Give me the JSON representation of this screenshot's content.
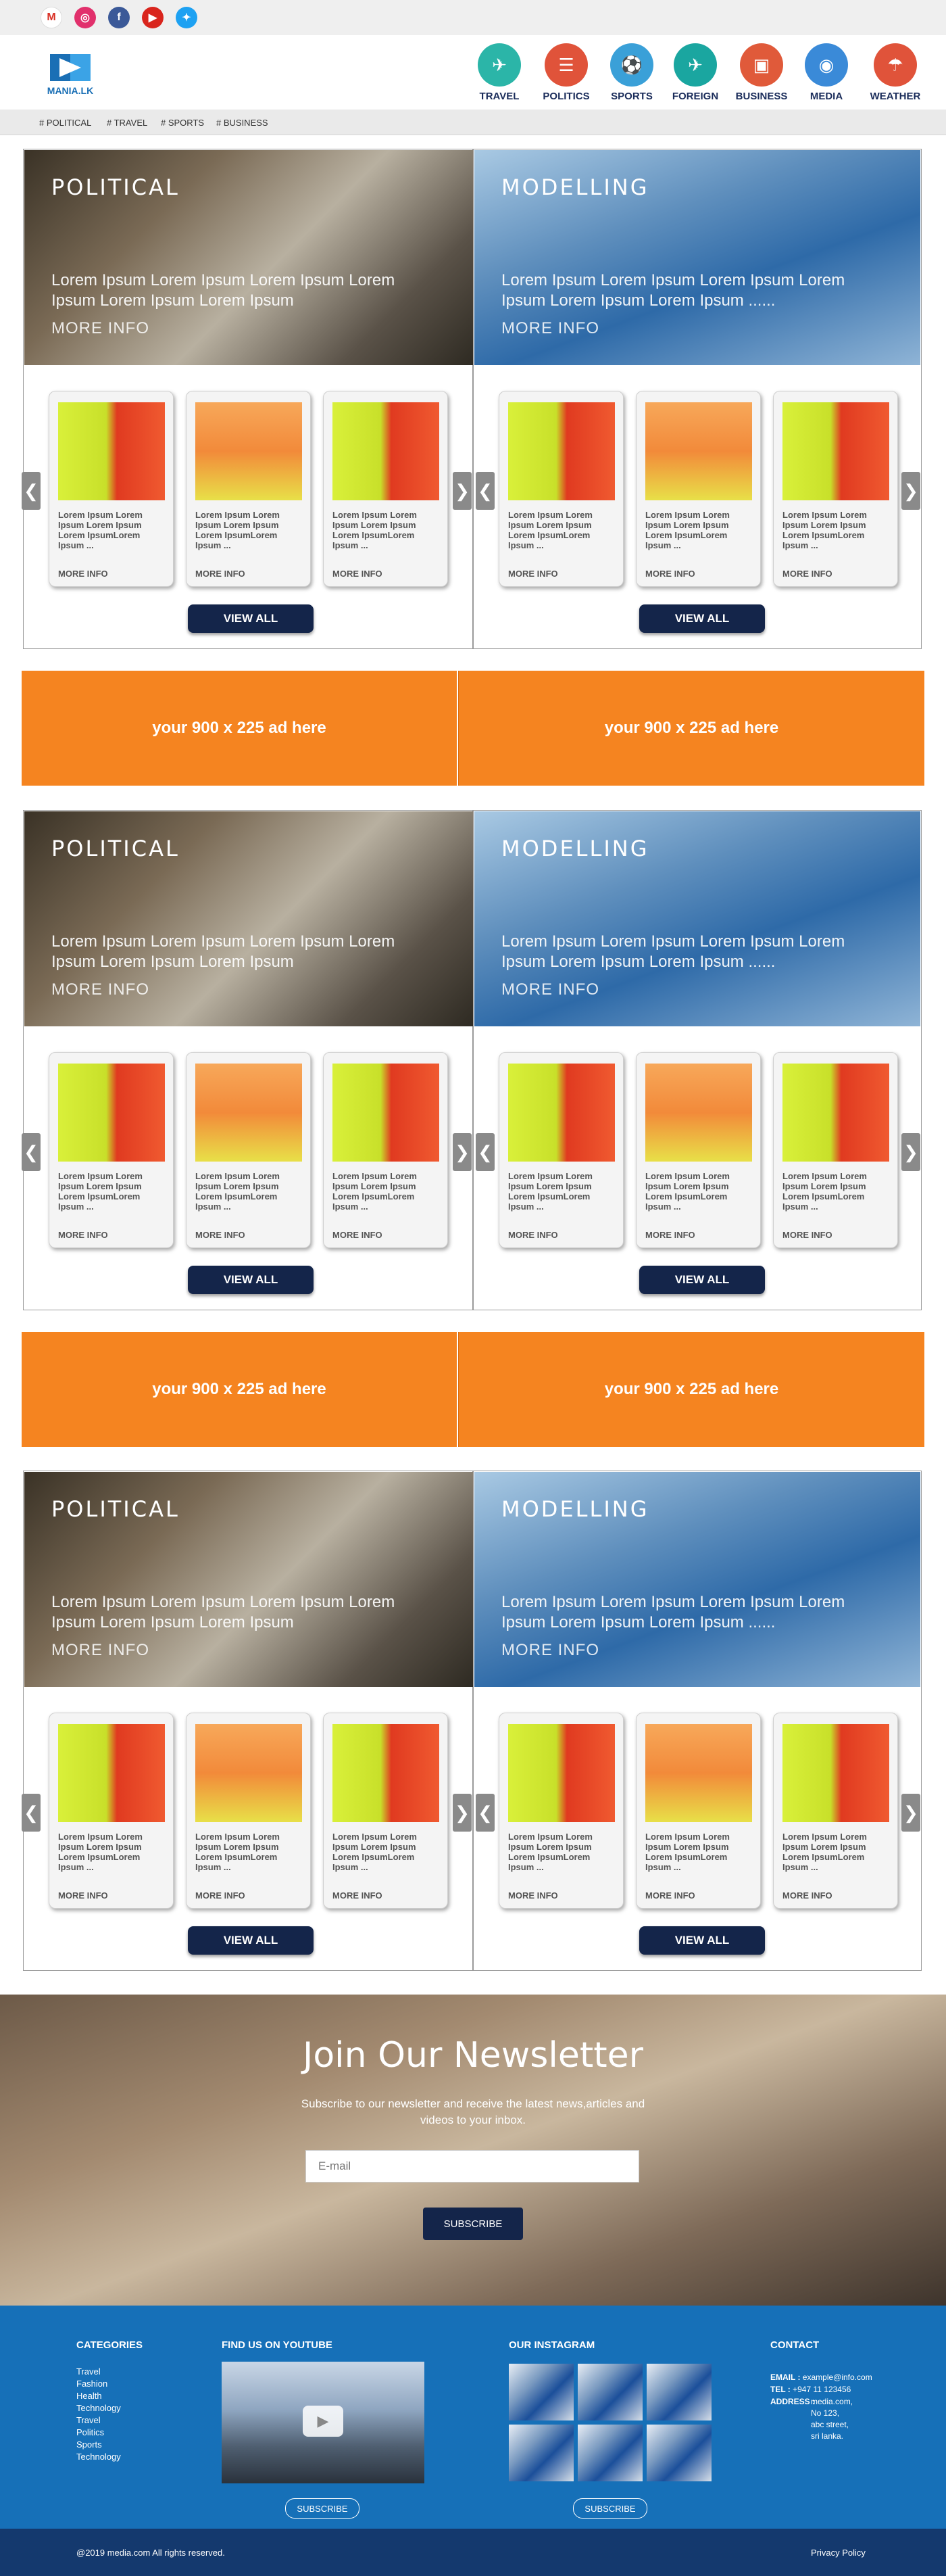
{
  "social": {
    "icons": [
      "gmail-icon",
      "instagram-icon",
      "facebook-icon",
      "youtube-icon",
      "twitter-icon"
    ]
  },
  "header": {
    "logo_text": "MANIA.LK",
    "nav": [
      "TRAVEL",
      "POLITICS",
      "SPORTS",
      "FOREIGN",
      "BUSINESS",
      "MEDIA",
      "WEATHER"
    ]
  },
  "tags": [
    "# POLITICAL",
    "# TRAVEL",
    "# SPORTS",
    "# BUSINESS"
  ],
  "sections": {
    "left_title": "POLITICAL",
    "right_title": "MODELLING",
    "desc_left": "Lorem Ipsum Lorem Ipsum Lorem Ipsum Lorem Ipsum  Lorem Ipsum  Lorem Ipsum",
    "desc_right": "Lorem Ipsum Lorem Ipsum Lorem Ipsum Lorem Ipsum Lorem Ipsum  Lorem Ipsum ......",
    "more_info": "MORE INFO",
    "card_text": "Lorem Ipsum  Lorem Ipsum Lorem Ipsum Lorem IpsumLorem Ipsum ...",
    "card_more": "MORE INFO",
    "view_all": "VIEW ALL",
    "arrow_left": "❮",
    "arrow_right": "❯"
  },
  "ads": {
    "label": "your 900 x 225 ad here"
  },
  "newsletter": {
    "title": "Join Our Newsletter",
    "subtitle": "Subscribe to our newsletter and receive the latest news,articles and videos to your inbox.",
    "email_placeholder": "E-mail",
    "button": "SUBSCRIBE"
  },
  "footer": {
    "categories_title": "CATEGORIES",
    "categories": [
      "Travel",
      "Fashion",
      "Health",
      "Technology",
      "Travel",
      "Politics",
      "Sports",
      "Technology"
    ],
    "youtube_title": "FIND US ON YOUTUBE",
    "youtube_button": "SUBSCRIBE",
    "instagram_title": "OUR INSTAGRAM",
    "instagram_button": "SUBSCRIBE",
    "contact_title": "CONTACT",
    "email_label": "EMAIL :",
    "email_value": "example@info.com",
    "tel_label": "TEL :",
    "tel_value": "+947 11 123456",
    "address_label": "ADDRESS :",
    "address_lines": [
      "media.com,",
      "No 123,",
      "abc street,",
      "sri lanka."
    ],
    "copyright": "@2019 media.com All rights reserved.",
    "privacy": "Privacy Policy"
  },
  "colors": {
    "brand_blue": "#1670b8",
    "navy": "#14254a",
    "ad_orange": "#f58420"
  }
}
